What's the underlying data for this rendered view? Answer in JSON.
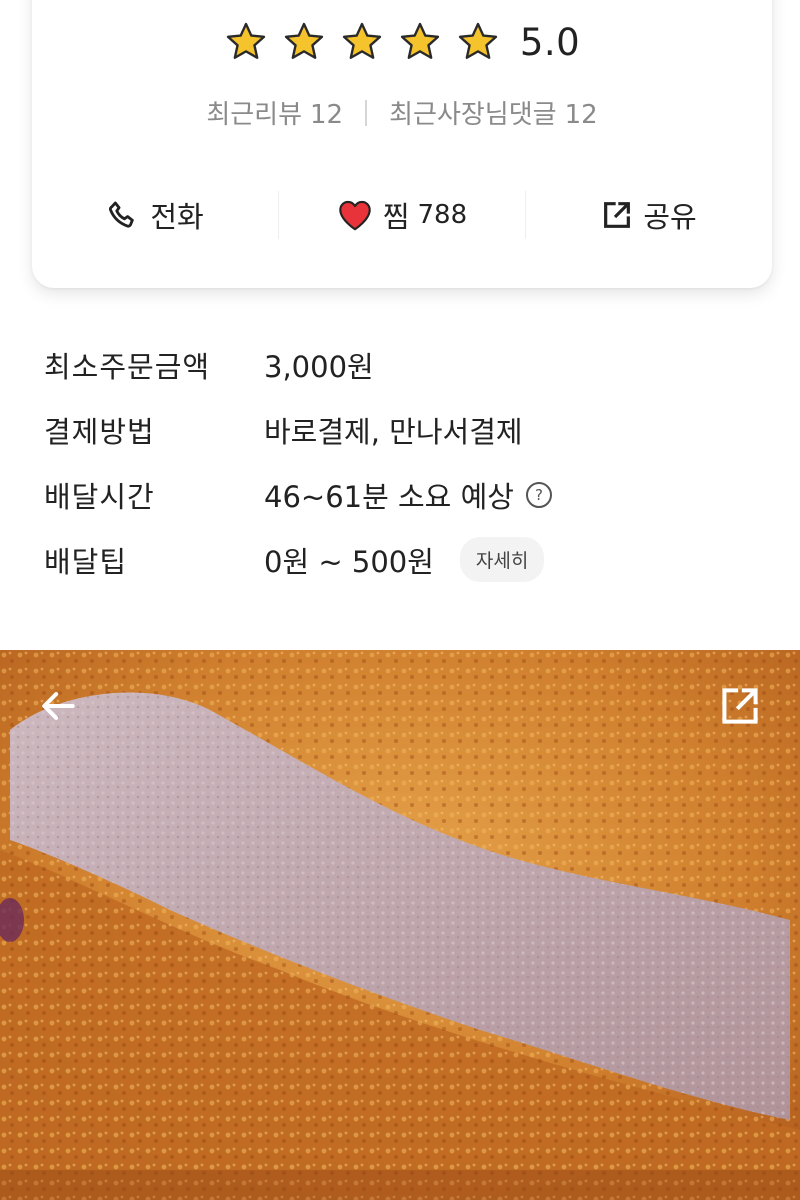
{
  "rating": {
    "stars": 5,
    "value": "5.0",
    "star_color": "#f5c32c"
  },
  "reviews": {
    "recent_reviews_label": "최근리뷰",
    "recent_reviews_count": "12",
    "owner_replies_label": "최근사장님댓글",
    "owner_replies_count": "12"
  },
  "actions": {
    "call_label": "전화",
    "like_label": "찜",
    "like_count": "788",
    "share_label": "공유",
    "heart_color": "#e8333a"
  },
  "info": [
    {
      "label": "최소주문금액",
      "value": "3,000원"
    },
    {
      "label": "결제방법",
      "value": "바로결제, 만나서결제"
    },
    {
      "label": "배달시간",
      "value": "46~61분 소요 예상",
      "help_icon": "question-circle-icon"
    },
    {
      "label": "배달팁",
      "value": "0원 ~ 500원",
      "detail_button": "자세히"
    }
  ],
  "photo": {
    "back_icon": "arrow-left-icon",
    "share_icon": "share-icon"
  }
}
